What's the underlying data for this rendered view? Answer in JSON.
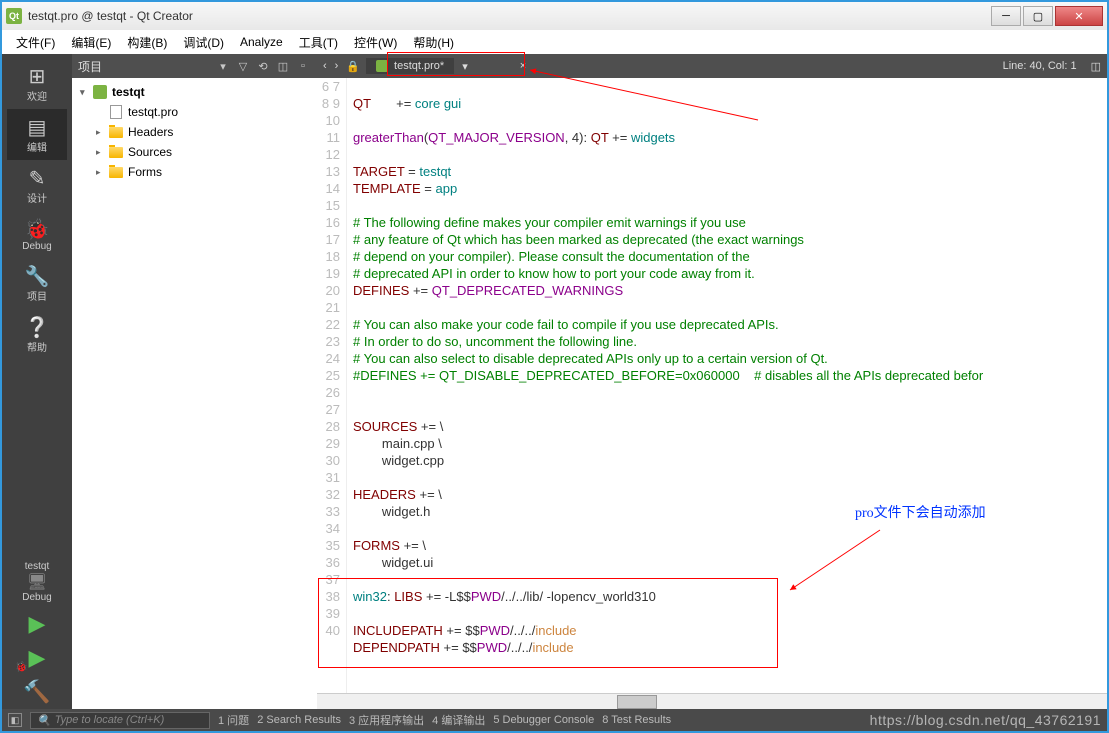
{
  "window": {
    "title": "testqt.pro @ testqt - Qt Creator"
  },
  "menu": {
    "items": [
      "文件(F)",
      "编辑(E)",
      "构建(B)",
      "调试(D)",
      "Analyze",
      "工具(T)",
      "控件(W)",
      "帮助(H)"
    ]
  },
  "side_tools": {
    "welcome": "欢迎",
    "edit": "编辑",
    "design": "设计",
    "debug": "Debug",
    "projects": "项目",
    "help": "帮助"
  },
  "kit": {
    "target": "testqt",
    "config": "Debug"
  },
  "project_panel": {
    "title": "项目"
  },
  "tree": {
    "root": "testqt",
    "nodes": [
      "testqt.pro",
      "Headers",
      "Sources",
      "Forms"
    ]
  },
  "editor": {
    "tab": "testqt.pro*",
    "tab_dropdown": "▾",
    "close": "×",
    "nav_back": "‹",
    "nav_fwd": "›",
    "status": "Line: 40, Col: 1",
    "first_line_no": 6,
    "code_lines": [
      "",
      "QT       += core gui",
      "",
      "greaterThan(QT_MAJOR_VERSION, 4): QT += widgets",
      "",
      "TARGET = testqt",
      "TEMPLATE = app",
      "",
      "# The following define makes your compiler emit warnings if you use",
      "# any feature of Qt which has been marked as deprecated (the exact warnings",
      "# depend on your compiler). Please consult the documentation of the",
      "# deprecated API in order to know how to port your code away from it.",
      "DEFINES += QT_DEPRECATED_WARNINGS",
      "",
      "# You can also make your code fail to compile if you use deprecated APIs.",
      "# In order to do so, uncomment the following line.",
      "# You can also select to disable deprecated APIs only up to a certain version of Qt.",
      "#DEFINES += QT_DISABLE_DEPRECATED_BEFORE=0x060000    # disables all the APIs deprecated befor",
      "",
      "",
      "SOURCES += \\",
      "        main.cpp \\",
      "        widget.cpp",
      "",
      "HEADERS += \\",
      "        widget.h",
      "",
      "FORMS += \\",
      "        widget.ui",
      "",
      "win32: LIBS += -L$$PWD/../../lib/ -lopencv_world310",
      "",
      "INCLUDEPATH += $$PWD/../../include",
      "DEPENDPATH += $$PWD/../../include",
      ""
    ]
  },
  "statusbar": {
    "locator_placeholder": "Type to locate (Ctrl+K)",
    "panes": [
      "1 问题",
      "2 Search Results",
      "3 应用程序输出",
      "4 编译输出",
      "5 Debugger Console",
      "8 Test Results"
    ]
  },
  "annotations": {
    "text1": "pro文件下会自动添加"
  },
  "watermark": "https://blog.csdn.net/qq_43762191"
}
